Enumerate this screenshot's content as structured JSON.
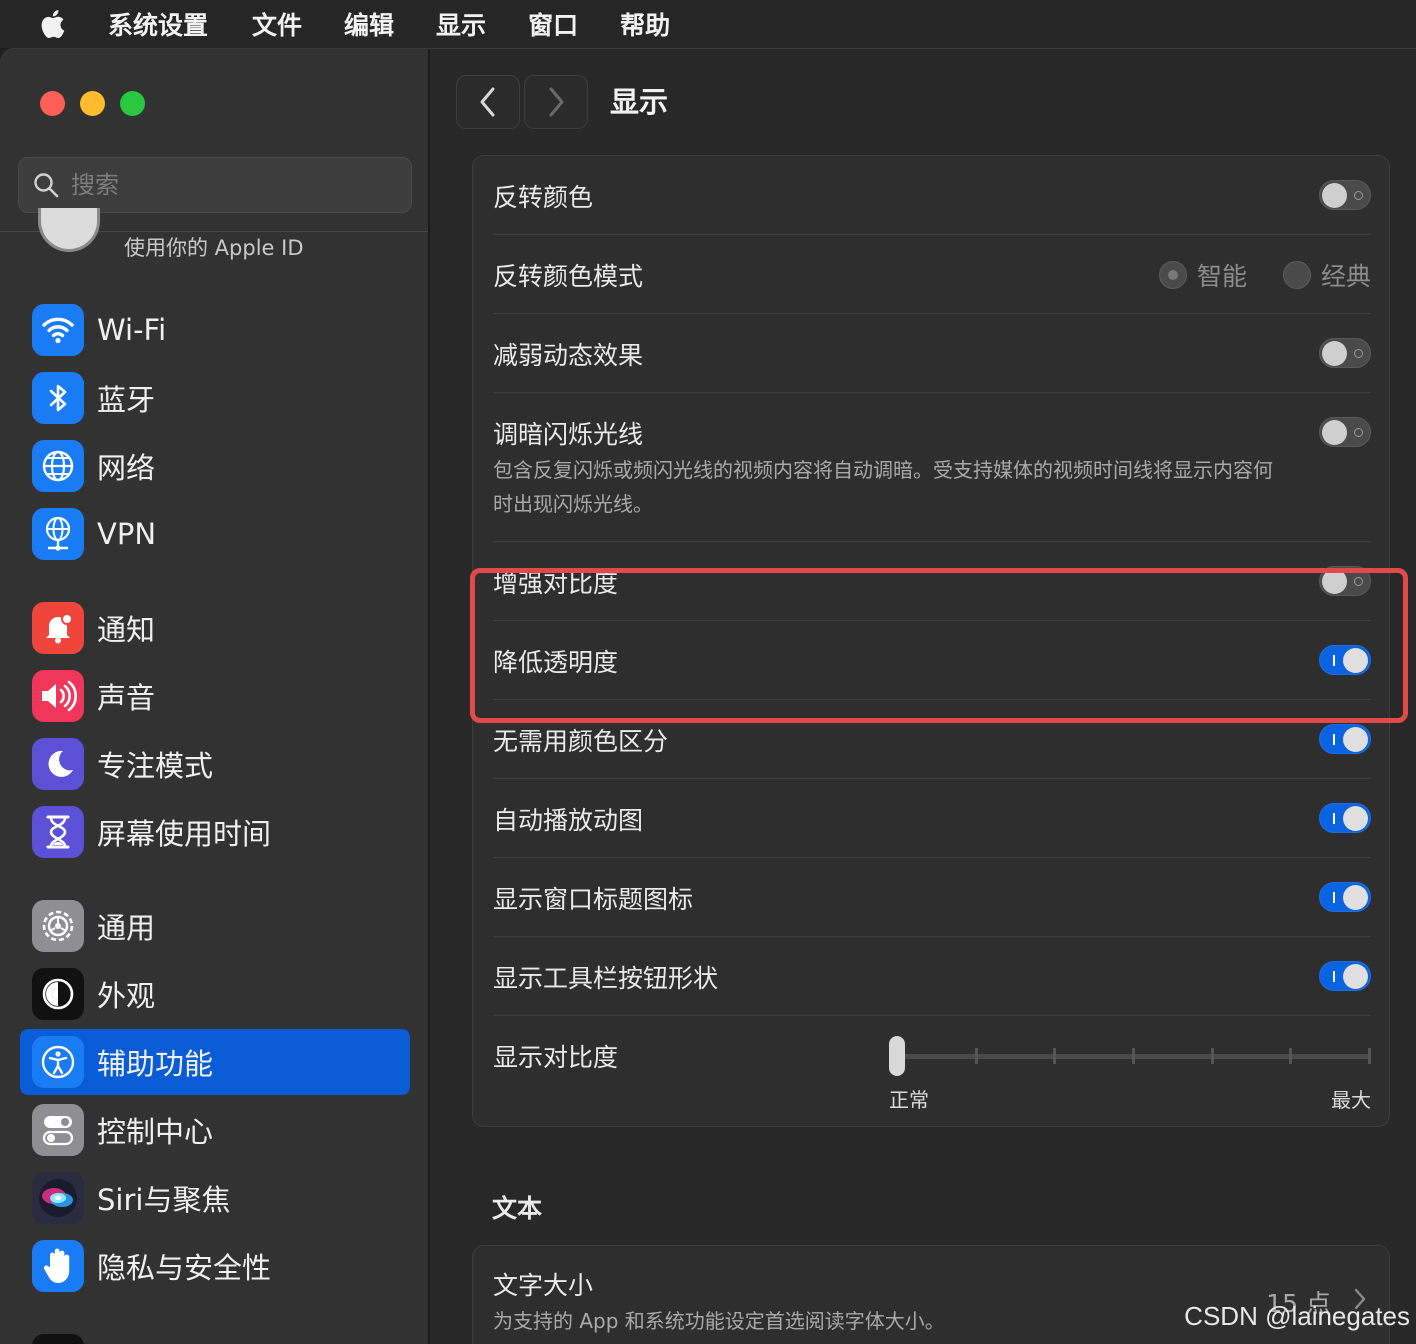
{
  "menubar": {
    "apple_icon": "apple-logo",
    "items": [
      "系统设置",
      "文件",
      "编辑",
      "显示",
      "窗口",
      "帮助"
    ]
  },
  "sidebar": {
    "search_placeholder": "搜索",
    "apple_id_text": "使用你的 Apple ID",
    "groups": [
      [
        {
          "label": "Wi-Fi",
          "icon": "wifi-icon",
          "color": "#1a7cf5"
        },
        {
          "label": "蓝牙",
          "icon": "bluetooth-icon",
          "color": "#1a7cf5"
        },
        {
          "label": "网络",
          "icon": "globe-icon",
          "color": "#1a7cf5"
        },
        {
          "label": "VPN",
          "icon": "vpn-globe-icon",
          "color": "#1a7cf5"
        }
      ],
      [
        {
          "label": "通知",
          "icon": "bell-icon",
          "color": "#f0453a"
        },
        {
          "label": "声音",
          "icon": "speaker-icon",
          "color": "#f0365a"
        },
        {
          "label": "专注模式",
          "icon": "moon-icon",
          "color": "#5b50d6"
        },
        {
          "label": "屏幕使用时间",
          "icon": "hourglass-icon",
          "color": "#5b50d6"
        }
      ],
      [
        {
          "label": "通用",
          "icon": "gear-icon",
          "color": "#8e8e93"
        },
        {
          "label": "外观",
          "icon": "appearance-icon",
          "color": "#111111"
        },
        {
          "label": "辅助功能",
          "icon": "accessibility-icon",
          "color": "#1a7cf5",
          "active": true
        },
        {
          "label": "控制中心",
          "icon": "switches-icon",
          "color": "#8e8e93"
        },
        {
          "label": "Siri与聚焦",
          "icon": "siri-icon",
          "color": "#2a2a40"
        },
        {
          "label": "隐私与安全性",
          "icon": "hand-icon",
          "color": "#1a7cf5"
        }
      ]
    ]
  },
  "main": {
    "title": "显示",
    "back_icon": "chevron-left-icon",
    "forward_icon": "chevron-right-icon",
    "rows": {
      "invert": {
        "label": "反转颜色",
        "on": false
      },
      "invert_mode": {
        "label": "反转颜色模式",
        "options": [
          "智能",
          "经典"
        ],
        "selected": "智能"
      },
      "reduce_motion": {
        "label": "减弱动态效果",
        "on": false
      },
      "dim_flash": {
        "label": "调暗闪烁光线",
        "desc": "包含反复闪烁或频闪光线的视频内容将自动调暗。受支持媒体的视频时间线将显示内容何时出现闪烁光线。",
        "on": false
      },
      "contrast": {
        "label": "增强对比度",
        "on": false
      },
      "reduce_transparency": {
        "label": "降低透明度",
        "on": true
      },
      "differentiate": {
        "label": "无需用颜色区分",
        "on": true
      },
      "autoplay": {
        "label": "自动播放动图",
        "on": true
      },
      "window_icons": {
        "label": "显示窗口标题图标",
        "on": true
      },
      "toolbar_shapes": {
        "label": "显示工具栏按钮形状",
        "on": true
      },
      "display_contrast": {
        "label": "显示对比度",
        "min_label": "正常",
        "max_label": "最大",
        "value_fraction": 0,
        "ticks": 7
      }
    },
    "text_section": {
      "title": "文本",
      "text_size": {
        "label": "文字大小",
        "desc": "为支持的 App 和系统功能设定首选阅读字体大小。",
        "value": "15 点"
      }
    },
    "highlight_color": "#e24a4a"
  },
  "watermark": "CSDN @lainegates"
}
